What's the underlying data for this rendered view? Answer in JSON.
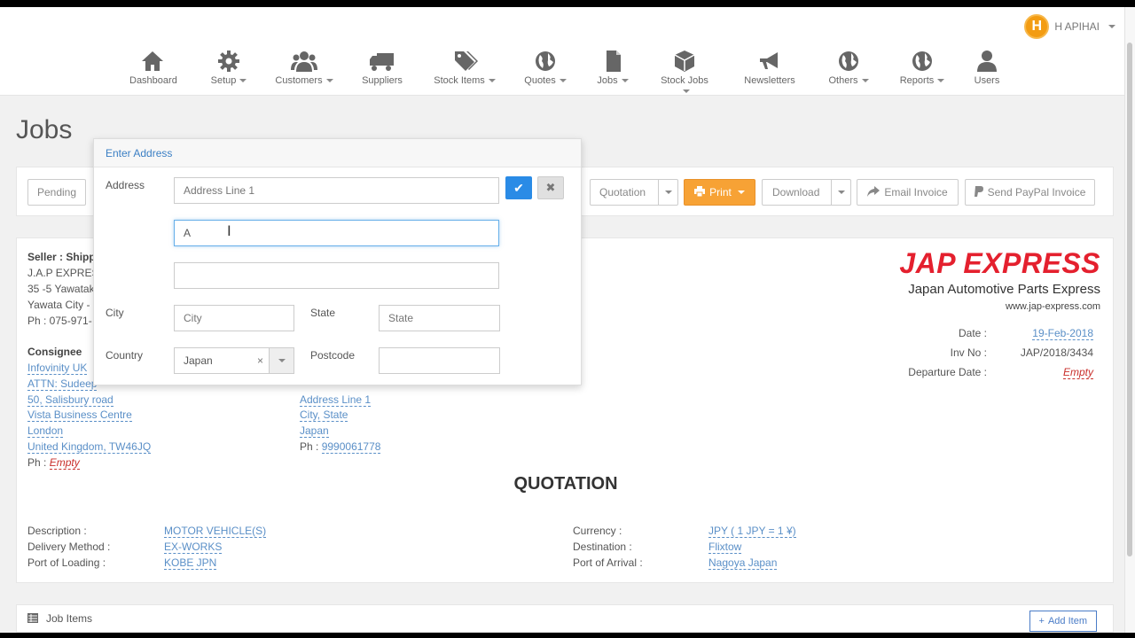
{
  "user": {
    "logo": "H",
    "name": "H APIHAI"
  },
  "nav": [
    {
      "label": "Dashboard",
      "icon": "home-icon",
      "dropdown": false
    },
    {
      "label": "Setup",
      "icon": "gear-icon",
      "dropdown": true
    },
    {
      "label": "Customers",
      "icon": "users-icon",
      "dropdown": true
    },
    {
      "label": "Suppliers",
      "icon": "truck-icon",
      "dropdown": false
    },
    {
      "label": "Stock Items",
      "icon": "tags-icon",
      "dropdown": true
    },
    {
      "label": "Quotes",
      "icon": "globe-icon",
      "dropdown": true
    },
    {
      "label": "Jobs",
      "icon": "file-icon",
      "dropdown": true
    },
    {
      "label": "Stock Jobs",
      "icon": "cube-icon",
      "dropdown": true
    },
    {
      "label": "Newsletters",
      "icon": "bullhorn-icon",
      "dropdown": false
    },
    {
      "label": "Others",
      "icon": "globe-icon",
      "dropdown": true
    },
    {
      "label": "Reports",
      "icon": "globe-icon",
      "dropdown": true
    },
    {
      "label": "Users",
      "icon": "user-icon",
      "dropdown": false
    }
  ],
  "page_title": "Jobs",
  "toolbar": {
    "pending": "Pending",
    "quotation": "Quotation",
    "print": "Print",
    "download": "Download",
    "email_invoice": "Email Invoice",
    "send_paypal": "Send PayPal Invoice"
  },
  "seller": {
    "heading": "Seller : Shippe",
    "line1": "J.A.P EXPRES",
    "line2": "35 -5 Yawatak",
    "line3": "Yawata City -",
    "phone": "Ph : 075-971-"
  },
  "consignee": {
    "heading": "Consignee",
    "name": "Infovinity UK",
    "attn": "ATTN: Sudeep",
    "address1": "50, Salisbury road",
    "address2": "Vista Business Centre",
    "city": "London",
    "country": "United Kingdom, TW46JQ",
    "phone_label": "Ph :",
    "phone": "Empty"
  },
  "notify": {
    "address1": "Address Line 1",
    "city_state": "City, State",
    "country": "Japan",
    "phone_label": "Ph :",
    "phone": "9990061778"
  },
  "brand": {
    "name": "JAP EXPRESS",
    "sub": "Japan Automotive Parts Express",
    "url": "www.jap-express.com"
  },
  "meta": {
    "date_label": "Date :",
    "date": "19-Feb-2018",
    "inv_label": "Inv No :",
    "inv": "JAP/2018/3434",
    "departure_label": "Departure Date :",
    "departure": "Empty"
  },
  "quotation_title": "QUOTATION",
  "details": {
    "description_label": "Description :",
    "description": "MOTOR VEHICLE(S)",
    "delivery_label": "Delivery Method :",
    "delivery": "EX-WORKS",
    "loading_label": "Port of Loading :",
    "loading": "KOBE JPN",
    "currency_label": "Currency :",
    "currency": "JPY ( 1 JPY = 1 ¥)",
    "destination_label": "Destination :",
    "destination": "Flixtow",
    "arrival_label": "Port of Arrival :",
    "arrival": "Nagoya Japan"
  },
  "job_items": {
    "label": "Job Items",
    "add_label": "Add Item"
  },
  "popover": {
    "title": "Enter Address",
    "address_label": "Address",
    "address1_placeholder": "Address Line 1",
    "address2_value": "A",
    "address3_value": "",
    "city_label": "City",
    "city_placeholder": "City",
    "state_label": "State",
    "state_placeholder": "State",
    "country_label": "Country",
    "country_value": "Japan",
    "postcode_label": "Postcode",
    "postcode_value": ""
  }
}
